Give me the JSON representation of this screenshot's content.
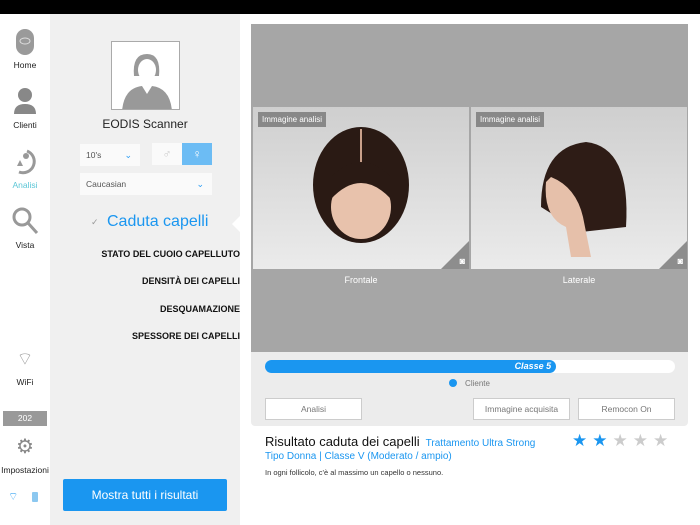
{
  "nav": {
    "home": "Home",
    "clients": "Clienti",
    "analysis": "Analisi",
    "view": "Vista",
    "wifi": "WiFi",
    "counter": "202",
    "settings": "Impostazioni"
  },
  "profile": {
    "name": "EODIS Scanner",
    "age": "10's",
    "ethnicity": "Caucasian",
    "gender_selected": "female"
  },
  "menu": {
    "title": "Caduta capelli",
    "items": [
      "STATO DEL CUOIO CAPELLUTO",
      "DENSITÀ DEI CAPELLI",
      "DESQUAMAZIONE",
      "SPESSORE DEI CAPELLI"
    ],
    "show_all": "Mostra tutti i risultati"
  },
  "images": {
    "tag": "Immagine analisi",
    "front": "Frontale",
    "side": "Laterale"
  },
  "progress": {
    "label": "Classe 5",
    "percent": 71,
    "legend": "Cliente"
  },
  "buttons": {
    "analysis": "Analisi",
    "acquired": "Immagine acquisita",
    "remocon": "Remocon On"
  },
  "result": {
    "title": "Risultato caduta dei capelli",
    "treatment": "Trattamento Ultra Strong",
    "subtitle": "Tipo Donna | Classe V (Moderato / ampio)",
    "description": "In ogni follicolo, c'è al massimo un capello o nessuno.",
    "stars": 2,
    "max_stars": 5
  },
  "colors": {
    "accent": "#1a96f0"
  }
}
